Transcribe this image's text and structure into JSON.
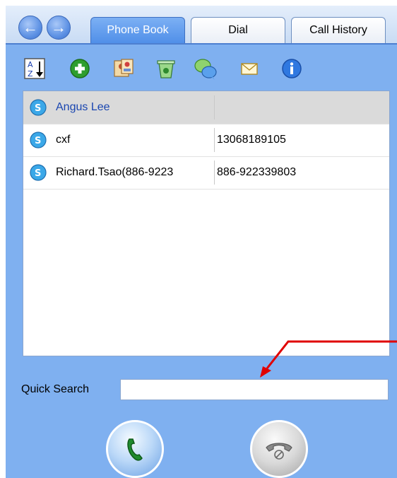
{
  "tabs": [
    {
      "label": "Phone Book",
      "active": true
    },
    {
      "label": "Dial",
      "active": false
    },
    {
      "label": "Call History",
      "active": false
    }
  ],
  "toolbar": {
    "icons": [
      "sort-az-icon",
      "add-contact-icon",
      "contacts-icon",
      "delete-icon",
      "chat-icon",
      "mail-icon",
      "info-icon"
    ]
  },
  "contacts": [
    {
      "name": "Angus Lee",
      "number": "",
      "selected": true
    },
    {
      "name": "cxf",
      "number": "13068189105",
      "selected": false
    },
    {
      "name": "Richard.Tsao(886-9223",
      "number": "886-922339803",
      "selected": false
    }
  ],
  "search": {
    "label": "Quick Search",
    "value": ""
  },
  "colors": {
    "panel_background": "#7fb0f0",
    "active_tab": "#4f8ee8",
    "selected_row": "#dadada",
    "selected_name": "#1a46b0",
    "annotation_arrow": "#e00000"
  }
}
